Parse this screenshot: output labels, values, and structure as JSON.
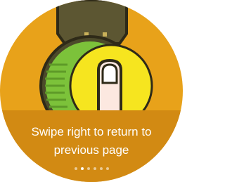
{
  "tutorial": {
    "caption_line1": "Swipe right to return to",
    "caption_line2": "previous page"
  },
  "pager": {
    "total_pages": 6,
    "current_page": 2
  },
  "colors": {
    "background": "#e8a21a",
    "caption_band": "#d28a13",
    "caption_text": "#ffffff",
    "watch_strap": "#5c5632",
    "watch_ring": "#7cc23a",
    "watch_face": "#f6e51f",
    "finger": "#fce8e0"
  },
  "icons": {
    "illustration": "watch-with-finger-swipe"
  }
}
